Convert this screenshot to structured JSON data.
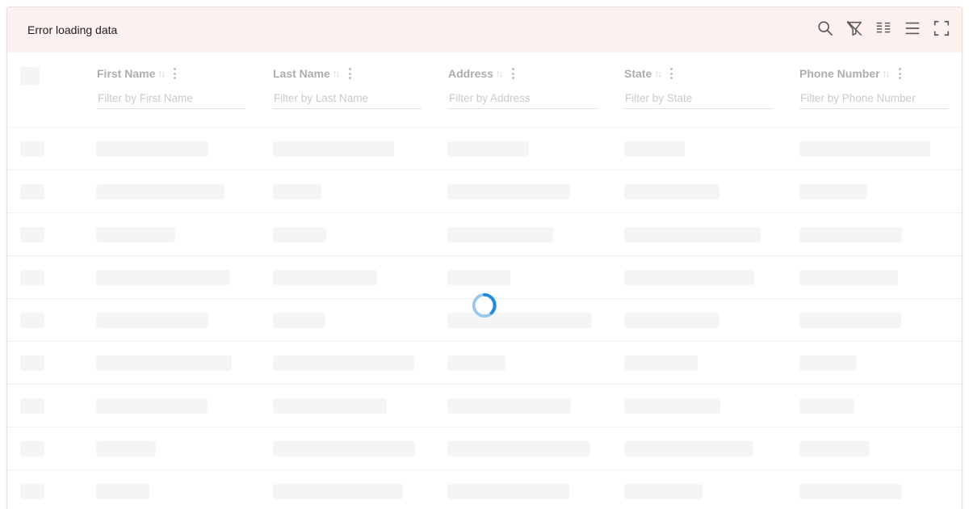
{
  "status": {
    "message": "Error loading data"
  },
  "toolbar": {
    "icons": [
      "search-icon",
      "clear-filter-icon",
      "columns-icon",
      "density-icon",
      "fullscreen-icon"
    ]
  },
  "table": {
    "columns": [
      {
        "title": "First Name",
        "filter_placeholder": "Filter by First Name"
      },
      {
        "title": "Last Name",
        "filter_placeholder": "Filter by Last Name"
      },
      {
        "title": "Address",
        "filter_placeholder": "Filter by Address"
      },
      {
        "title": "State",
        "filter_placeholder": "Filter by State"
      },
      {
        "title": "Phone Number",
        "filter_placeholder": "Filter by Phone Number"
      }
    ],
    "skeleton_row_count": 9,
    "state": "loading"
  },
  "colors": {
    "error_bar": "#fdf1ef",
    "skeleton": "#f4f5f5",
    "spinner": "#1e88e5",
    "icon": "#555555"
  }
}
